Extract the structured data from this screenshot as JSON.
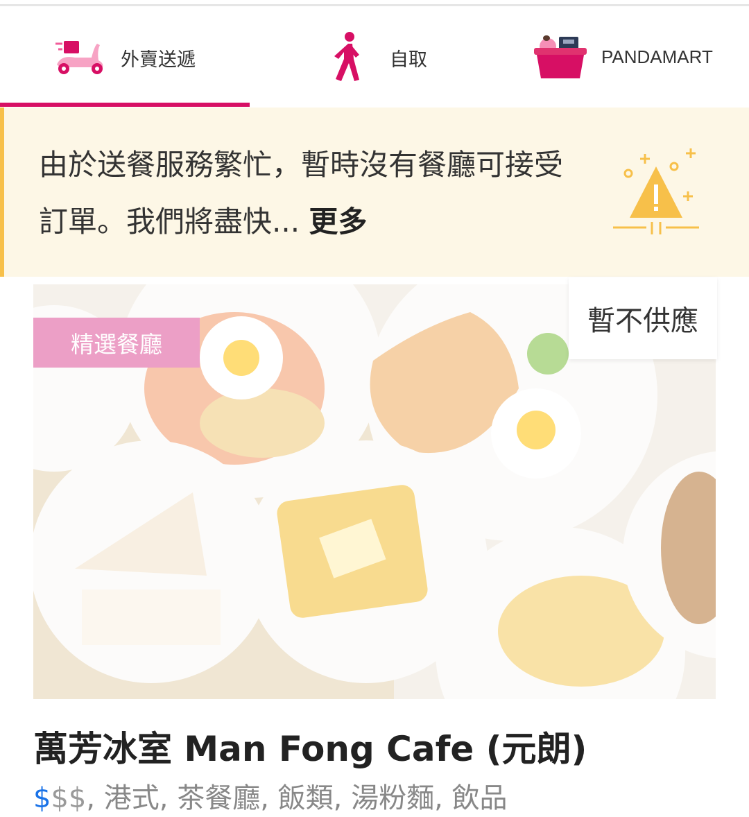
{
  "tabs": [
    {
      "label": "外賣送遞",
      "icon": "scooter-icon",
      "active": true
    },
    {
      "label": "自取",
      "icon": "walking-person-icon",
      "active": false
    },
    {
      "label": "PANDAMART",
      "icon": "basket-icon",
      "active": false
    }
  ],
  "banner": {
    "message": "由於送餐服務繁忙，暫時沒有餐廳可接受訂單。我們將盡快...",
    "more_label": "更多",
    "icon": "warning-icon"
  },
  "restaurant": {
    "featured_label": "精選餐廳",
    "unavailable_label": "暫不供應",
    "name": "萬芳冰室 Man Fong Cafe (元朗)",
    "price_active": "$",
    "price_inactive": "$$",
    "tags": ", 港式, 茶餐廳, 飯類, 湯粉麵, 飲品"
  },
  "colors": {
    "brand": "#d70f64",
    "banner_bg": "#fdf7e6",
    "banner_accent": "#f7c04a",
    "featured_badge": "#ec9fc6",
    "price_active": "#1a73e8"
  }
}
